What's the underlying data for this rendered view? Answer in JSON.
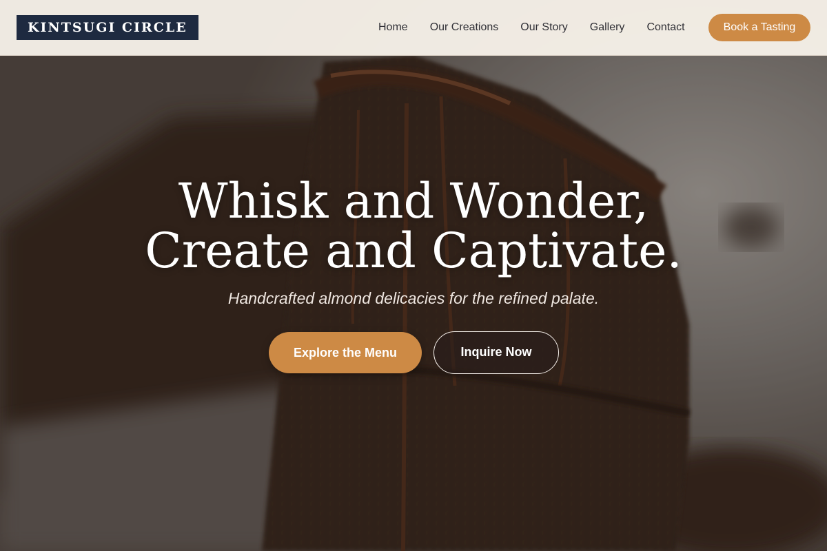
{
  "header": {
    "logo": "KINTSUGI CIRCLE",
    "nav": [
      {
        "label": "Home"
      },
      {
        "label": "Our Creations"
      },
      {
        "label": "Our Story"
      },
      {
        "label": "Gallery"
      },
      {
        "label": "Contact"
      }
    ],
    "cta": "Book a Tasting"
  },
  "hero": {
    "title_line1": "Whisk and Wonder,",
    "title_line2": "Create and Captivate.",
    "subtitle": "Handcrafted almond delicacies for the refined palate.",
    "primary_button": "Explore the Menu",
    "secondary_button": "Inquire Now",
    "background_image": "chocolate-cake-slices"
  },
  "colors": {
    "accent": "#cd8a45",
    "logo_bg": "#1e2a40",
    "header_bg": "#f6f0e8",
    "nav_text": "#2f2f35"
  }
}
